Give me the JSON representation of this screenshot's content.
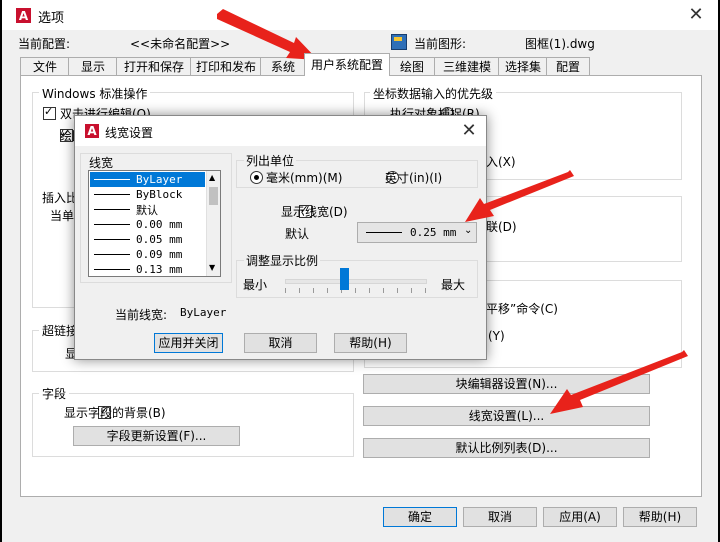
{
  "window": {
    "title": "选项",
    "current_profile_label": "当前配置:",
    "current_profile_value": "<<未命名配置>>",
    "current_drawing_label": "当前图形:",
    "current_drawing_value": "图框(1).dwg"
  },
  "tabs": [
    {
      "label": "文件"
    },
    {
      "label": "显示"
    },
    {
      "label": "打开和保存"
    },
    {
      "label": "打印和发布"
    },
    {
      "label": "系统"
    },
    {
      "label": "用户系统配置"
    },
    {
      "label": "绘图"
    },
    {
      "label": "三维建模"
    },
    {
      "label": "选择集"
    },
    {
      "label": "配置"
    }
  ],
  "left": {
    "windows_ops_label": "Windows 标准操作",
    "dblclick_edit": "双击进行编辑(O)",
    "cb2_partial": "绘图",
    "insert_partial": "插入比",
    "unit_partial": "当单位",
    "hyperlink_partial": "超链接",
    "display_partial": "显",
    "fields_label": "字段",
    "field_bg": "显示字段的背景(B)",
    "field_update_btn": "字段更新设置(F)..."
  },
  "right": {
    "coord_priority_label": "坐标数据输入的优先级",
    "exec_osnap": "执行对象捕捉(R)",
    "partial_x": "入(X)",
    "partial_d": "联(D)",
    "partial_pan": "平移”命令(C)",
    "partial_y": "(Y)",
    "block_editor_btn": "块编辑器设置(N)...",
    "lineweight_btn": "线宽设置(L)...",
    "scale_list_btn": "默认比例列表(D)..."
  },
  "bottom": {
    "ok": "确定",
    "cancel": "取消",
    "apply": "应用(A)",
    "help": "帮助(H)"
  },
  "dialog": {
    "title": "线宽设置",
    "lineweights_label": "线宽",
    "lineweights": [
      {
        "label": "ByLayer"
      },
      {
        "label": "ByBlock"
      },
      {
        "label": "默认"
      },
      {
        "label": "0.00 mm"
      },
      {
        "label": "0.05 mm"
      },
      {
        "label": "0.09 mm"
      },
      {
        "label": "0.13 mm"
      }
    ],
    "selected_index": 0,
    "units_label": "列出单位",
    "mm_label": "毫米(mm)(M)",
    "inch_label": "英寸(in)(I)",
    "show_lw_label": "显示线宽(D)",
    "default_label": "默认",
    "default_value": "0.25 mm",
    "scale_label": "调整显示比例",
    "scale_min": "最小",
    "scale_max": "最大",
    "scale_value": 0.42,
    "current_lw_label": "当前线宽:",
    "current_lw_value": "ByLayer",
    "apply_close": "应用并关闭",
    "cancel": "取消",
    "help": "帮助(H)"
  },
  "colors": {
    "accent": "#0078d7",
    "logo": "#c8102e",
    "arrow": "#e8221b"
  }
}
